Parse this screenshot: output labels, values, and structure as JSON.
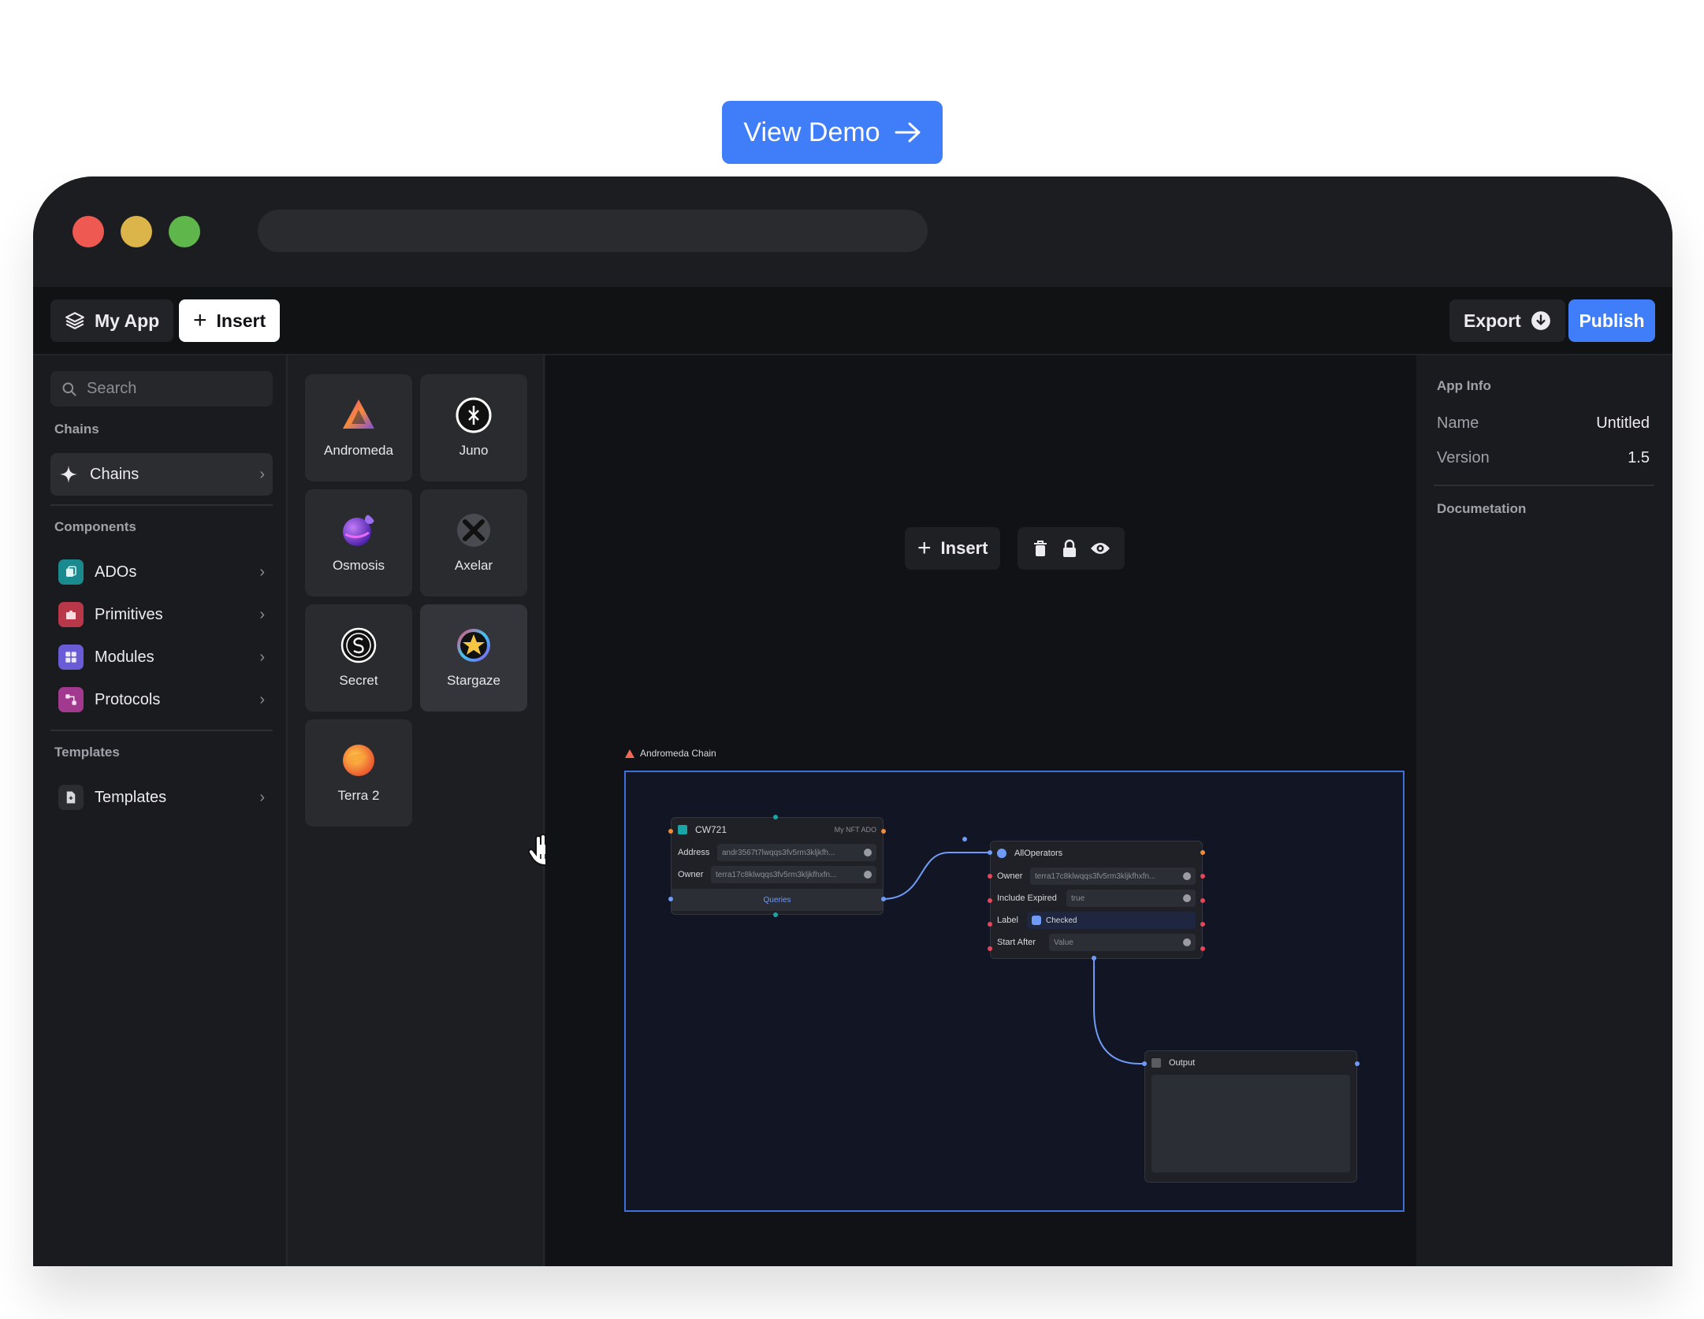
{
  "demo": {
    "label": "View Demo"
  },
  "toolbar": {
    "app_name": "My App",
    "insert_label": "Insert",
    "export_label": "Export",
    "publish_label": "Publish"
  },
  "sidebar": {
    "search_placeholder": "Search",
    "chains_section": "Chains",
    "chains_item": "Chains",
    "components_section": "Components",
    "components": [
      {
        "label": "ADOs",
        "color": "#1a8a8f"
      },
      {
        "label": "Primitives",
        "color": "#b8384a"
      },
      {
        "label": "Modules",
        "color": "#6a5bd6"
      },
      {
        "label": "Protocols",
        "color": "#a13a8e"
      }
    ],
    "templates_section": "Templates",
    "templates_item": "Templates"
  },
  "tiles": [
    "Andromeda",
    "Juno",
    "Osmosis",
    "Axelar",
    "Secret",
    "Stargaze",
    "Terra 2"
  ],
  "canvas": {
    "insert_label": "Insert",
    "frame_label": "Andromeda Chain",
    "cw721": {
      "title": "CW721",
      "subtitle": "My NFT ADO",
      "address_label": "Address",
      "address_value": "andr3567t7lwqqs3fv5rm3kljkfh...",
      "owner_label": "Owner",
      "owner_value": "terra17c8klwqqs3fv5rm3kljkfhxfn...",
      "queries_label": "Queries"
    },
    "alloperators": {
      "title": "AllOperators",
      "owner_label": "Owner",
      "owner_value": "terra17c8klwqqs3fv5rm3kljkfhxfn...",
      "expired_label": "Include Expired",
      "expired_value": "true",
      "label_label": "Label",
      "label_value": "Checked",
      "start_label": "Start After",
      "start_value": "Value"
    },
    "output": {
      "title": "Output"
    }
  },
  "rightpanel": {
    "app_info": "App Info",
    "name_label": "Name",
    "name_value": "Untitled",
    "version_label": "Version",
    "version_value": "1.5",
    "documentation": "Documetation"
  }
}
